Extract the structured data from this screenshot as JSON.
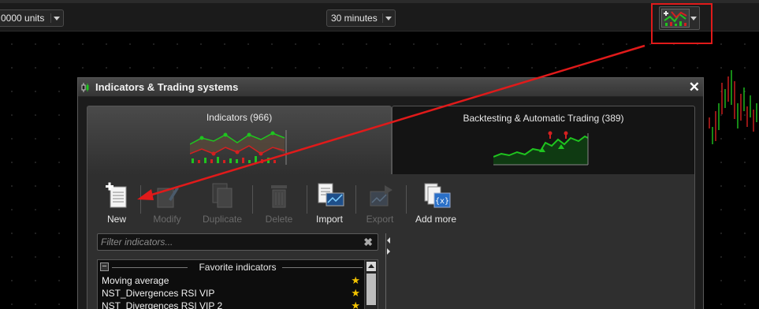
{
  "toolbar": {
    "units_value": "0000 units",
    "interval_value": "30 minutes",
    "indicators_button_icon": "indicators-chart-icon"
  },
  "dialog": {
    "title": "Indicators & Trading systems",
    "close_icon": "close-icon",
    "tabs": [
      {
        "label": "Indicators (966)"
      },
      {
        "label": "Backtesting & Automatic Trading (389)"
      }
    ],
    "actions": [
      {
        "label": "New",
        "icon": "new-document-icon",
        "enabled": true
      },
      {
        "label": "Modify",
        "icon": "modify-pencil-icon",
        "enabled": false
      },
      {
        "label": "Duplicate",
        "icon": "duplicate-icon",
        "enabled": false
      },
      {
        "label": "Delete",
        "icon": "trash-icon",
        "enabled": false
      },
      {
        "label": "Import",
        "icon": "import-icon",
        "enabled": true
      },
      {
        "label": "Export",
        "icon": "export-icon",
        "enabled": false
      },
      {
        "label": "Add more",
        "icon": "add-more-icon",
        "enabled": true
      }
    ],
    "filter_placeholder": "Filter indicators...",
    "clear_icon": "clear-icon",
    "list": {
      "group_title": "Favorite indicators",
      "items": [
        {
          "name": "Moving average"
        },
        {
          "name": "NST_Divergences RSI VIP"
        },
        {
          "name": "NST_Divergences RSI VIP 2"
        }
      ]
    }
  },
  "colors": {
    "annotation_red": "#e01a1a",
    "star_yellow": "#f2c200",
    "chart_green": "#1fc41f",
    "chart_red": "#d42020"
  }
}
